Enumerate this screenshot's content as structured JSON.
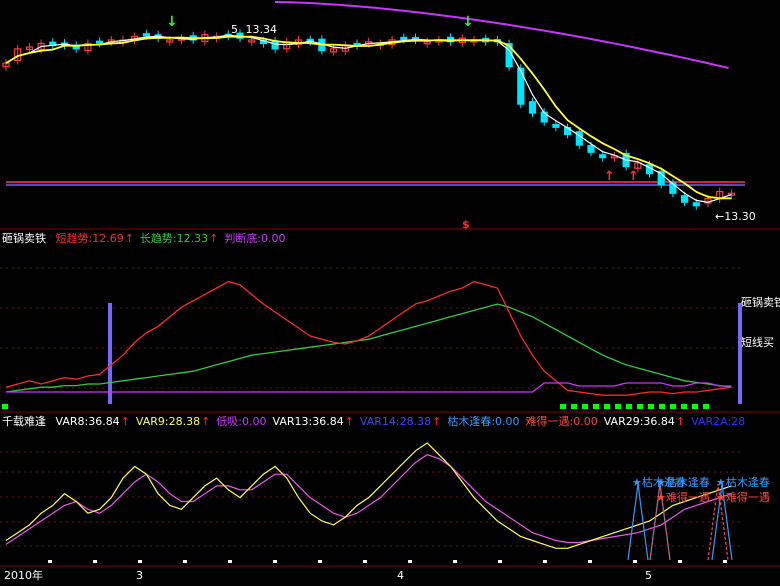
{
  "colors": {
    "bg": "#000000",
    "sep": "#8b0000",
    "grid": "#7a1010",
    "up": "#ff3b3b",
    "down": "#00e5ff",
    "ma5": "#ffffff",
    "ma10": "#ffff33",
    "ma60": "#cc33ff",
    "short": "#ff2a2a",
    "long": "#2ecc40",
    "judge": "#cc33ff",
    "bar": "#7766ff",
    "dot": "#00ff00",
    "var8": "#ffffff",
    "var9": "#ffff55",
    "var13": "#ffffff",
    "var14": "#4444ff",
    "kumu": "#3399ff",
    "nande": "#ff4444",
    "var29": "#ffffff",
    "var2a": "#3333ff",
    "kline": "#ee55ee"
  },
  "price_panel": {
    "hi_label": "5",
    "hi_value": "13.34",
    "lo_label": "←13.30",
    "dollar_mark": "$",
    "buy_arrow": "↓",
    "sell_arrow": "↑",
    "ma_type": "candlestick"
  },
  "ind1": {
    "name": "砸锅卖铁",
    "labels": [
      {
        "text": "短趋势:12.69",
        "color": "#ff2a2a"
      },
      {
        "text": "↑",
        "color": "#ff2a2a"
      },
      {
        "text": "长趋势:12.33",
        "color": "#2ecc40"
      },
      {
        "text": "↑",
        "color": "#ff2a2a"
      },
      {
        "text": "判断底:0.00",
        "color": "#cc33ff"
      }
    ],
    "side_tags": [
      "砸锅卖铁",
      "短线买"
    ]
  },
  "ind2": {
    "name": "千载难逢",
    "labels": [
      {
        "text": "VAR8:36.84",
        "color": "#ffffff"
      },
      {
        "text": "↑",
        "color": "#ff2a2a"
      },
      {
        "text": "VAR9:28.38",
        "color": "#ffff55"
      },
      {
        "text": "↑",
        "color": "#ff2a2a"
      },
      {
        "text": "低吸:0.00",
        "color": "#cc33ff"
      },
      {
        "text": "VAR13:36.84",
        "color": "#ffffff"
      },
      {
        "text": "↑",
        "color": "#ff2a2a"
      },
      {
        "text": "VAR14:28.38",
        "color": "#4444ff"
      },
      {
        "text": "↑",
        "color": "#ff2a2a"
      },
      {
        "text": "枯木逢春:0.00",
        "color": "#3399ff"
      },
      {
        "text": "难得一遇:0.00",
        "color": "#ff4444"
      },
      {
        "text": "VAR29:36.84",
        "color": "#ffffff"
      },
      {
        "text": "↑",
        "color": "#ff2a2a"
      },
      {
        "text": "VAR2A:28",
        "color": "#3333ff"
      }
    ],
    "tags": [
      {
        "text": "★枯木逢春",
        "color": "#3399ff"
      },
      {
        "text": "★枯木逢春",
        "color": "#3399ff"
      },
      {
        "text": "★枯木逢春",
        "color": "#3399ff"
      },
      {
        "text": "★难得一遇",
        "color": "#ff4444"
      },
      {
        "text": "★难得一遇",
        "color": "#ff4444"
      }
    ]
  },
  "x_axis": [
    "2010年",
    "3",
    "4",
    "5"
  ],
  "chart_data": [
    {
      "type": "candlestick",
      "title": "",
      "series": [
        {
          "name": "close",
          "values": [
            13.18,
            13.26,
            13.27,
            13.29,
            13.28,
            13.29,
            13.26,
            13.29,
            13.3,
            13.31,
            13.31,
            13.33,
            13.34,
            13.32,
            13.31,
            13.32,
            13.31,
            13.34,
            13.33,
            13.34,
            13.32,
            13.31,
            13.29,
            13.26,
            13.3,
            13.31,
            13.3,
            13.25,
            13.26,
            13.28,
            13.29,
            13.3,
            13.29,
            13.31,
            13.32,
            13.31,
            13.3,
            13.31,
            13.3,
            13.32,
            13.31,
            13.3,
            13.3,
            13.16,
            12.95,
            12.9,
            12.85,
            12.82,
            12.78,
            12.72,
            12.68,
            12.65,
            12.66,
            12.6,
            12.62,
            12.56,
            12.5,
            12.45,
            12.4,
            12.38,
            12.42,
            12.46,
            12.45
          ]
        }
      ],
      "annotations": [
        "5  13.34",
        "←13.30"
      ],
      "price_range": [
        12.3,
        13.45
      ]
    },
    {
      "type": "line",
      "title": "砸锅卖铁",
      "series": [
        {
          "name": "短趋势",
          "values": [
            8,
            10,
            12,
            10,
            12,
            14,
            13,
            15,
            16,
            22,
            28,
            36,
            42,
            46,
            52,
            58,
            62,
            66,
            70,
            74,
            72,
            66,
            60,
            55,
            50,
            45,
            40,
            38,
            36,
            35,
            37,
            40,
            45,
            50,
            55,
            60,
            62,
            65,
            68,
            70,
            74,
            72,
            70,
            55,
            40,
            28,
            18,
            12,
            6,
            5,
            4,
            3,
            3,
            3,
            4,
            5,
            5,
            4,
            5,
            5,
            6,
            7,
            8
          ]
        },
        {
          "name": "长趋势",
          "values": [
            5,
            6,
            7,
            8,
            8,
            9,
            9,
            10,
            10,
            11,
            12,
            13,
            14,
            15,
            16,
            17,
            18,
            20,
            22,
            24,
            26,
            28,
            29,
            30,
            31,
            32,
            33,
            34,
            35,
            36,
            37,
            38,
            40,
            42,
            44,
            46,
            48,
            50,
            52,
            54,
            56,
            58,
            60,
            58,
            55,
            52,
            48,
            44,
            40,
            36,
            32,
            28,
            25,
            22,
            20,
            18,
            16,
            14,
            12,
            11,
            10,
            9,
            8
          ]
        },
        {
          "name": "判断底",
          "values": [
            0,
            0,
            0,
            0,
            0,
            0,
            0,
            0,
            0,
            0,
            0,
            0,
            0,
            0,
            0,
            0,
            0,
            0,
            0,
            0,
            0,
            0,
            0,
            0,
            0,
            0,
            0,
            0,
            0,
            0,
            0,
            0,
            0,
            0,
            0,
            0,
            0,
            0,
            0,
            0,
            0,
            0,
            0,
            0,
            0,
            0,
            3,
            3,
            3,
            2,
            2,
            2,
            2,
            3,
            3,
            3,
            3,
            2,
            2,
            3,
            3,
            2,
            2
          ]
        }
      ]
    },
    {
      "type": "line",
      "title": "千载难逢",
      "series": [
        {
          "name": "VAR8",
          "values": [
            10,
            14,
            18,
            24,
            28,
            34,
            30,
            24,
            26,
            32,
            42,
            48,
            44,
            34,
            28,
            26,
            32,
            38,
            42,
            36,
            32,
            38,
            44,
            48,
            42,
            32,
            24,
            20,
            18,
            22,
            28,
            32,
            38,
            44,
            50,
            56,
            60,
            54,
            48,
            40,
            32,
            26,
            20,
            16,
            12,
            10,
            8,
            6,
            6,
            8,
            10,
            12,
            14,
            16,
            18,
            20,
            24,
            28,
            30,
            32,
            34,
            36,
            38
          ]
        },
        {
          "name": "VAR9",
          "values": [
            8,
            12,
            16,
            20,
            24,
            28,
            30,
            26,
            24,
            28,
            34,
            40,
            44,
            40,
            34,
            30,
            30,
            34,
            38,
            38,
            36,
            36,
            40,
            44,
            44,
            38,
            32,
            28,
            24,
            22,
            24,
            28,
            32,
            38,
            44,
            50,
            54,
            52,
            48,
            42,
            36,
            30,
            26,
            22,
            18,
            14,
            12,
            10,
            9,
            9,
            10,
            11,
            12,
            13,
            14,
            16,
            18,
            22,
            26,
            28,
            30,
            32,
            34
          ]
        }
      ],
      "events": [
        "枯木逢春",
        "难得一遇"
      ]
    }
  ]
}
